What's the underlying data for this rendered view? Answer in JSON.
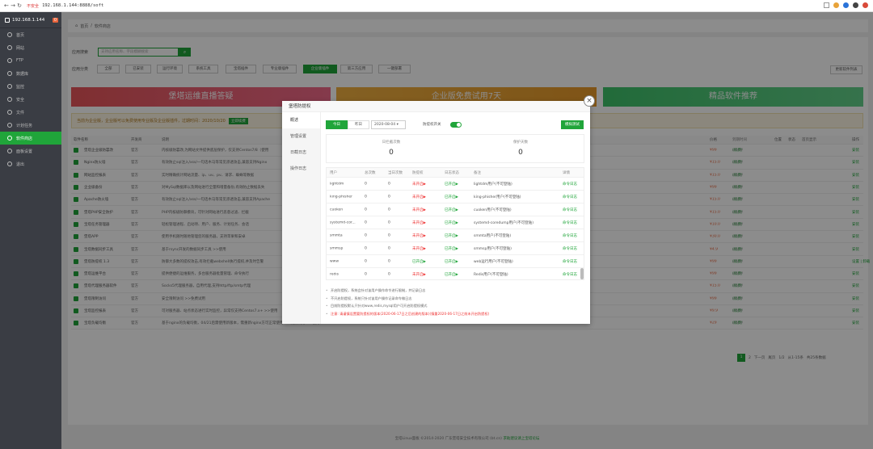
{
  "browser": {
    "not_secure": "不安全",
    "url": "192.168.1.144:8888/soft"
  },
  "sidebar": {
    "host": "192.168.1.144",
    "badge": "0",
    "items": [
      {
        "label": "首页"
      },
      {
        "label": "网站"
      },
      {
        "label": "FTP"
      },
      {
        "label": "数据库"
      },
      {
        "label": "监控"
      },
      {
        "label": "安全"
      },
      {
        "label": "文件"
      },
      {
        "label": "计划任务"
      },
      {
        "label": "软件商店"
      },
      {
        "label": "面板设置"
      },
      {
        "label": "退出"
      }
    ]
  },
  "breadcrumb": {
    "home": "首页",
    "sep": "/",
    "current": "软件商店"
  },
  "search": {
    "label": "应用搜索",
    "placeholder": "支持应用名称、字段模糊搜索"
  },
  "category": {
    "label": "应用分类",
    "items": [
      "全部",
      "已安装",
      "运行环境",
      "系统工具",
      "宝塔插件",
      "专业版插件",
      "企业版插件",
      "第三方应用",
      "一键部署"
    ]
  },
  "update_button": "更新软件列表",
  "banners": [
    "堡塔运维直播答疑",
    "企业版免费试用7天",
    "精品软件推荐"
  ],
  "notice": {
    "text": "当前为企业版，企业版可以免费使用专业版及企业版插件，过期时间：2020/10/20",
    "button": "立即续费"
  },
  "table": {
    "headers": {
      "name": "软件名称",
      "dev": "开发商",
      "desc": "说明",
      "price": "价格",
      "exp": "到期时间",
      "pos": "位置",
      "status": "状态",
      "home": "首页显示",
      "op": "操作"
    },
    "rows": [
      {
        "name": "堡塔企业级防篡改",
        "dev": "官方",
        "desc": "内核级防篡改,为网站文件提供底层保护，仅支持Centos7/8（使用",
        "price": "¥99",
        "exp": "2020/10/20",
        "renew": "(续费)",
        "op": "安装"
      },
      {
        "name": "Nginx防火墙",
        "dev": "官方",
        "desc": "有效防止sql注入/xss/一句话木马等常见渗透攻击,兼容支持Nginx",
        "price": "¥15.0",
        "exp": "2020/10/20",
        "renew": "(续费)",
        "op": "安装"
      },
      {
        "name": "网站监控报表",
        "dev": "官方",
        "desc": "实时精确统计网站流量、ip、uv、pv、请求、蜘蛛等数据",
        "price": "¥15.0",
        "exp": "2020/10/20",
        "renew": "(续费)",
        "op": "安装"
      },
      {
        "name": "企业级备份",
        "dev": "官方",
        "desc": "对MySql数据库以及网站进行全量和增量备份,有效防止数据丢失",
        "price": "¥99",
        "exp": "2020/10/20",
        "renew": "(续费)",
        "op": "安装"
      },
      {
        "name": "Apache防火墙",
        "dev": "官方",
        "desc": "有效防止sql注入/xss/一句话木马等常见渗透攻击,兼容支持Apache",
        "price": "¥15.0",
        "exp": "2020/10/20",
        "renew": "(续费)",
        "op": "安装"
      },
      {
        "name": "堡塔PHP安全防护",
        "dev": "官方",
        "desc": "PHP内核级防御模块，可针对网站进行恶意过滤、拦截",
        "price": "¥15.0",
        "exp": "2020/10/20",
        "renew": "(续费)",
        "op": "安装"
      },
      {
        "name": "宝塔任务管理器",
        "dev": "官方",
        "desc": "轻松管理进程、启动项、用户、服务、计划任务、会话",
        "price": "¥10.0",
        "exp": "2020/10/20",
        "renew": "(续费)",
        "op": "安装"
      },
      {
        "name": "堡塔APP",
        "dev": "官方",
        "desc": "使用手机随时随地管理您的服务器，支持苹果和安卓",
        "price": "¥30.0",
        "exp": "2020/10/20",
        "renew": "(续费)",
        "op": "安装"
      },
      {
        "name": "宝塔数据同步工具",
        "dev": "官方",
        "desc": "基于rsync开发的数据同步工具 >>使用",
        "price": "¥4.9",
        "exp": "2020/10/20",
        "renew": "(续费)",
        "op": "安装"
      },
      {
        "name": "堡塔防提权 1.3",
        "dev": "官方",
        "desc": "防御大多数的提权攻击,有效拦截webshell执行提权,并及时告警",
        "price": "¥99",
        "exp": "2020/10/20",
        "renew": "(续费)",
        "op": "设置 | 卸载"
      },
      {
        "name": "堡塔运维平台",
        "dev": "官方",
        "desc": "提供便捷的运维服务，多台服务器批量管理、命令执行",
        "price": "¥99",
        "exp": "2020/10/20",
        "renew": "(续费)",
        "op": "安装"
      },
      {
        "name": "堡塔代理服务器软件",
        "dev": "官方",
        "desc": "Socks5代理服务器，自用代理,支持http/ftp/smtp代理",
        "price": "¥15.0",
        "exp": "2020/10/20",
        "renew": "(续费)",
        "op": "安装"
      },
      {
        "name": "堡塔限制访问",
        "dev": "官方",
        "desc": "安全限制访问 >>免费试用",
        "price": "¥99",
        "exp": "2020/10/20",
        "renew": "(续费)",
        "op": "安装"
      },
      {
        "name": "宝塔监控报表",
        "dev": "官方",
        "desc": "可对服务器、站点状态进行实时监控，异常仅支持Centos7.x+ >>使用",
        "price": "¥9.9",
        "exp": "2020/10/20",
        "renew": "(续费)",
        "op": "安装"
      },
      {
        "name": "宝塔负载均衡",
        "dev": "官方",
        "desc": "基于nginx的负载均衡，04/21后需使用新版本，需重新nginx方可正常使用 >>免费试用 >>使用",
        "price": "¥29",
        "exp": "2020/10/20",
        "renew": "(续费)",
        "op": "安装"
      }
    ]
  },
  "pager": {
    "current": "1",
    "next_page": "2",
    "next": "下一页",
    "last": "尾页",
    "pages": "1/2",
    "range": "从1-15条",
    "total": "共25条数据"
  },
  "footer": {
    "copyright": "宝塔Linux面板 ©2014-2020 广东堡塔安全技术有限公司 (bt.cn)",
    "link": "求助建议请上宝塔论坛"
  },
  "modal": {
    "title": "堡塔防提权",
    "close": "×",
    "side": [
      "概述",
      "管理设置",
      "日截日志",
      "操作日志"
    ],
    "tabs": [
      "今日",
      "昨日"
    ],
    "date": "2020-08-04",
    "protect_label": "防提权开关",
    "sim_button": "模拟测试",
    "stats": [
      {
        "label": "日拦截次数",
        "value": "0"
      },
      {
        "label": "保护天数",
        "value": "0"
      }
    ],
    "table_headers": {
      "user": "用户",
      "total": "总次数",
      "today": "当日次数",
      "prot": "防提权",
      "log": "日志状态",
      "note": "备注",
      "op": "详情"
    },
    "rows": [
      {
        "user": "lightdm",
        "total": "0",
        "today": "0",
        "prot": "未开启▶",
        "log": "已开启▶",
        "note": "lightdm用户(不可登陆)",
        "op": "命令日志"
      },
      {
        "user": "king-phisher",
        "total": "0",
        "today": "0",
        "prot": "未开启▶",
        "log": "已开启▶",
        "note": "king-phisher用户(不可登陆)",
        "op": "命令日志"
      },
      {
        "user": "cuoken",
        "total": "0",
        "today": "0",
        "prot": "未开启▶",
        "log": "已开启▶",
        "note": "cuoken用户(不可登陆)",
        "op": "命令日志"
      },
      {
        "user": "systemd-cor...",
        "total": "0",
        "today": "0",
        "prot": "未开启▶",
        "log": "已开启▶",
        "note": "systemd-coredump用户(不可登陆)",
        "op": "命令日志"
      },
      {
        "user": "smmta",
        "total": "0",
        "today": "0",
        "prot": "未开启▶",
        "log": "已开启▶",
        "note": "smmta用户(不可登陆)",
        "op": "命令日志"
      },
      {
        "user": "smmsp",
        "total": "0",
        "today": "0",
        "prot": "未开启▶",
        "log": "已开启▶",
        "note": "smmsp用户(不可登陆)",
        "op": "命令日志"
      },
      {
        "user": "www",
        "total": "0",
        "today": "0",
        "prot": "已开启▶",
        "log": "已开启▶",
        "note": "web运行用户(不可登陆)",
        "op": "命令日志"
      },
      {
        "user": "redis",
        "total": "0",
        "today": "0",
        "prot": "未开启▶",
        "log": "已开启▶",
        "note": "Redis用户(不可登陆)",
        "op": "命令日志"
      }
    ],
    "notes": [
      "开启防提权，系统会针对该用户操作命令进行限制，并记录日志",
      "不开启防提权，系统只针对该用户操作记录命令做日志",
      "目前防提权默认只针对www,redis,mysql用户可开启防提权模式",
      "注意: 请谨慎设置要防提权的版本(2020-06-17日之后创建的版本)(慎重2020-06-17日之前未开启防提权)"
    ]
  }
}
